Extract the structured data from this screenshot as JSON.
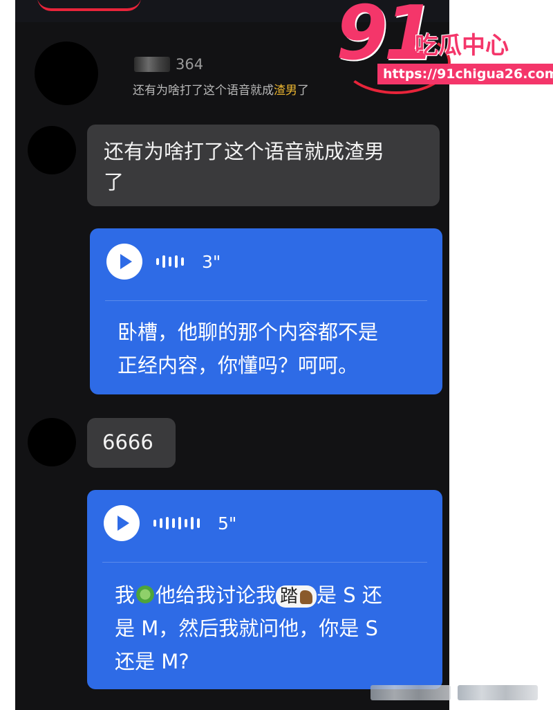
{
  "quote": {
    "count": "364",
    "text_prefix": "还有为啥打了这个语音就成",
    "text_highlight": "渣男",
    "text_suffix": "了"
  },
  "messages": [
    {
      "type": "text",
      "text_line1": "还有为啥打了这个语音就成渣男",
      "text_line2": "了"
    },
    {
      "type": "voice",
      "duration": "3\"",
      "transcript_line1": "卧槽，他聊的那个内容都不是",
      "transcript_line2": "正经内容，你懂吗？呵呵。"
    },
    {
      "type": "text",
      "text": "6666"
    },
    {
      "type": "voice",
      "duration": "5\"",
      "transcript_part1": "我",
      "transcript_part2": "他给我讨论我",
      "sticker_text": "踏",
      "transcript_part3": "是 S 还",
      "transcript_line2": "是 M，然后我就问他，你是 S",
      "transcript_line3": "还是 M?"
    }
  ],
  "watermark": {
    "logo_number": "91",
    "logo_name": "吃瓜中心",
    "url": "https://91chigua26.com"
  },
  "icons": {
    "play": "play-icon",
    "wave": "voice-wave-icon",
    "leaf": "leaf-emoji",
    "horse": "horse-emoji"
  },
  "colors": {
    "background": "#121214",
    "gray_bubble": "#3a3a3c",
    "voice_bubble": "#2e6be6",
    "highlight": "#e9b430",
    "watermark": "#f4366a"
  }
}
